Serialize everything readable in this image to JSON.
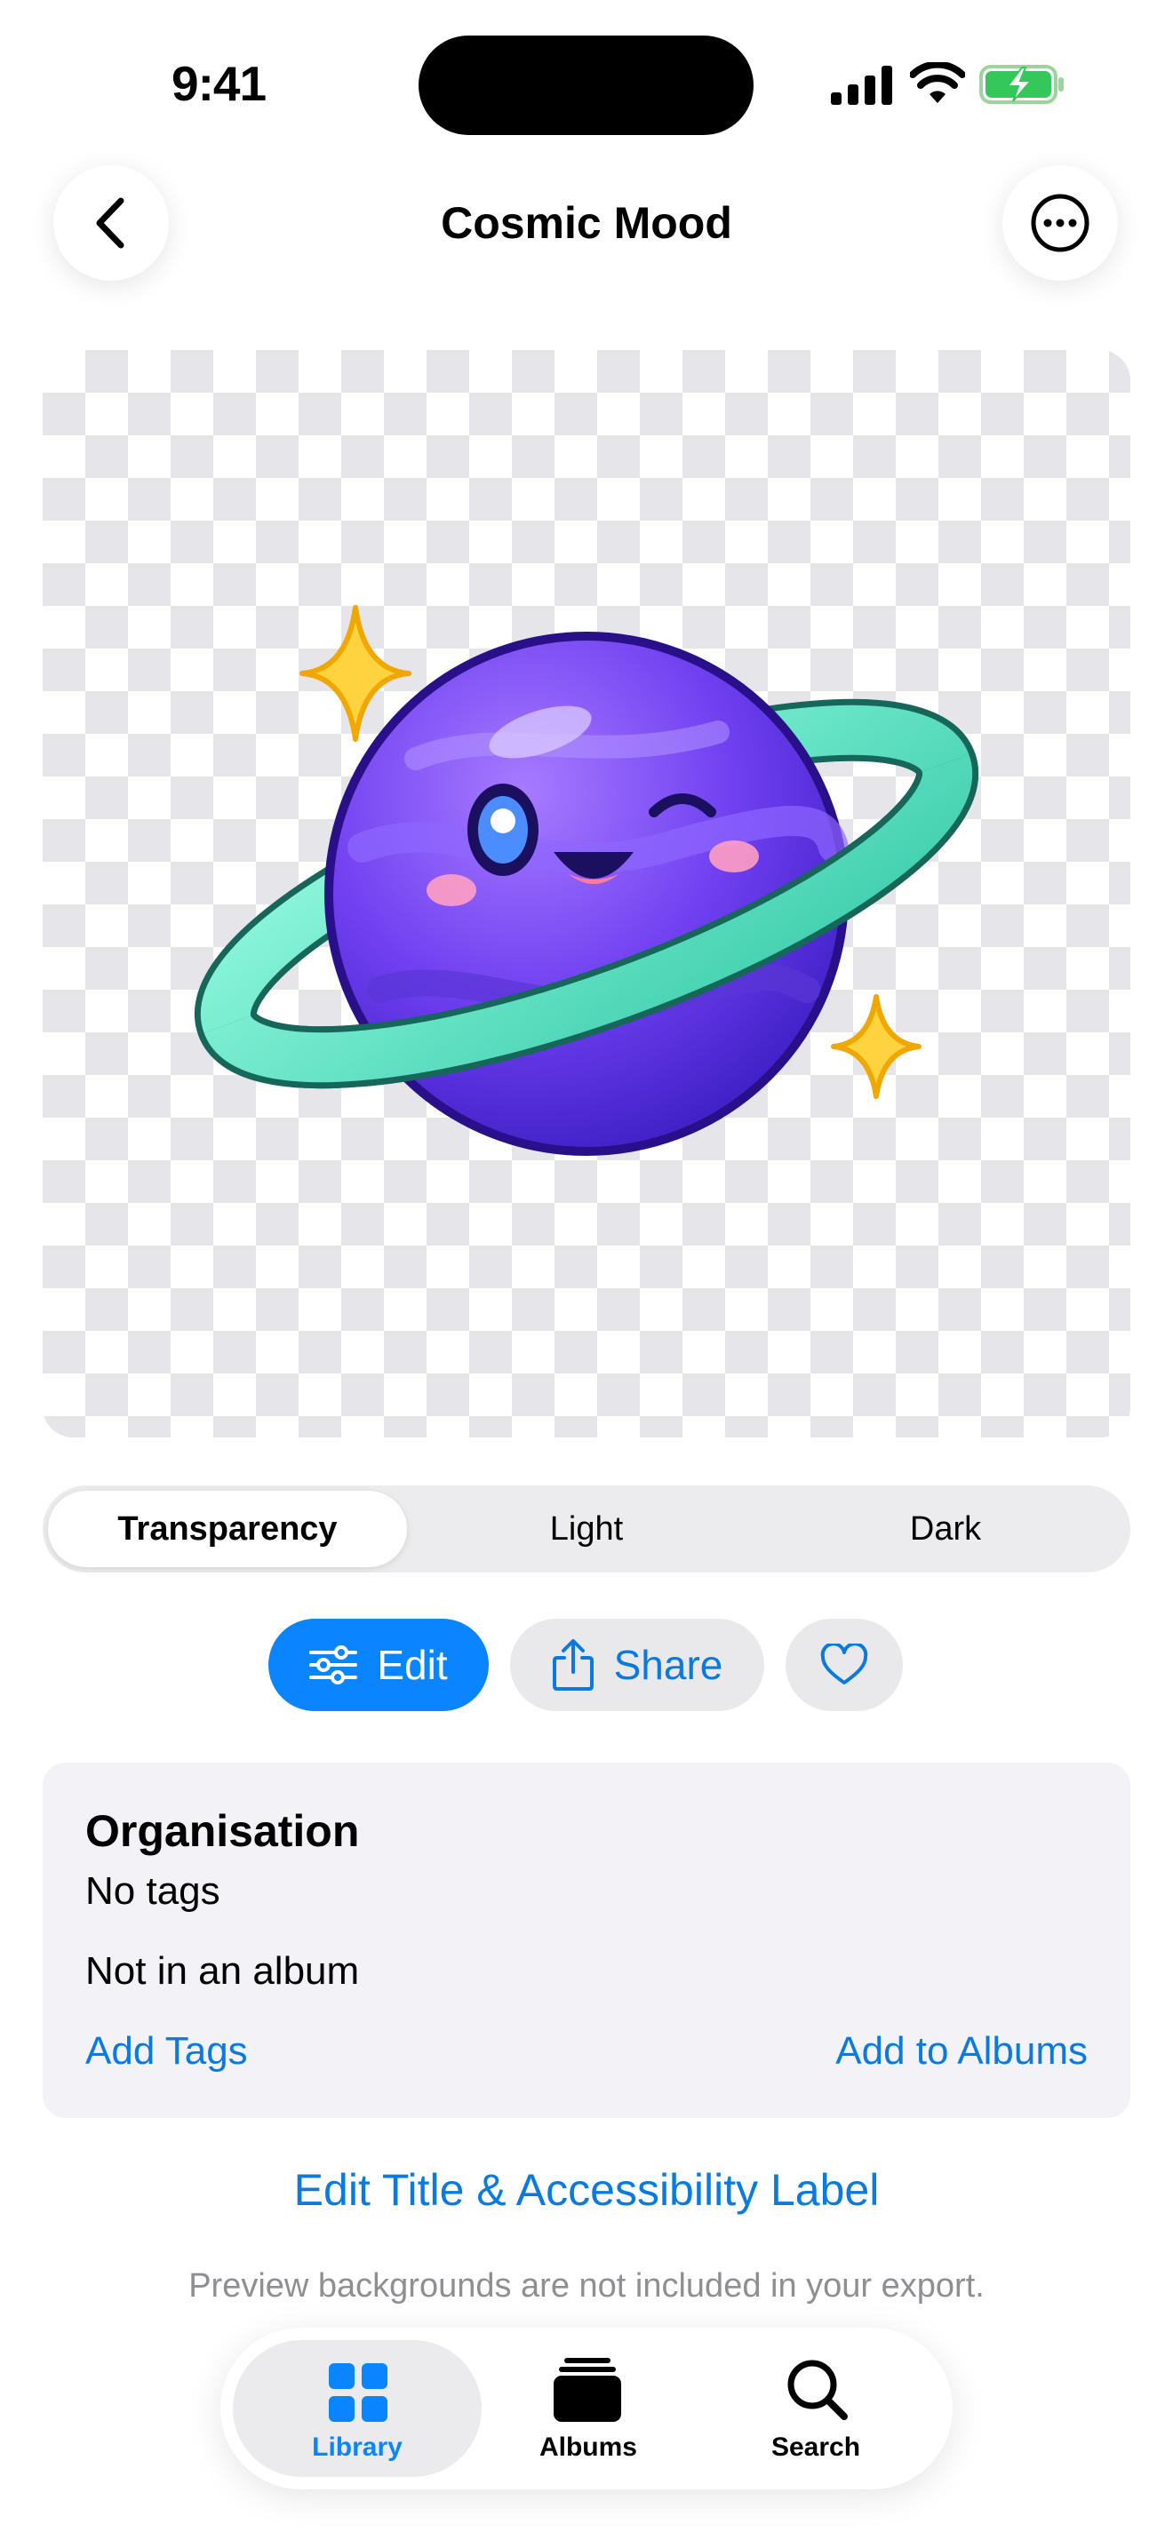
{
  "status_bar": {
    "time": "9:41"
  },
  "header": {
    "title": "Cosmic Mood"
  },
  "icons": {
    "back": "chevron-left-icon",
    "more": "ellipsis-circle-icon",
    "edit": "sliders-icon",
    "share": "share-icon",
    "favorite": "heart-icon",
    "library": "grid-icon",
    "albums": "stack-icon",
    "search": "magnifier-icon"
  },
  "preview_modes": {
    "options": [
      "Transparency",
      "Light",
      "Dark"
    ],
    "selected": "Transparency"
  },
  "actions": {
    "edit_label": "Edit",
    "share_label": "Share"
  },
  "organisation": {
    "title": "Organisation",
    "tags": "No tags",
    "album": "Not in an album",
    "add_tags": "Add Tags",
    "add_to_albums": "Add to Albums"
  },
  "edit_title_link": "Edit Title & Accessibility Label",
  "footnote": "Preview backgrounds are not included in your export.",
  "tabs": [
    {
      "label": "Library",
      "active": true
    },
    {
      "label": "Albums",
      "active": false
    },
    {
      "label": "Search",
      "active": false
    }
  ],
  "colors": {
    "accent": "#0A84FF",
    "link": "#0A7AE0",
    "planet": "#7B4BF0",
    "ring": "#5FE0C0",
    "sparkle": "#FFD23F"
  }
}
